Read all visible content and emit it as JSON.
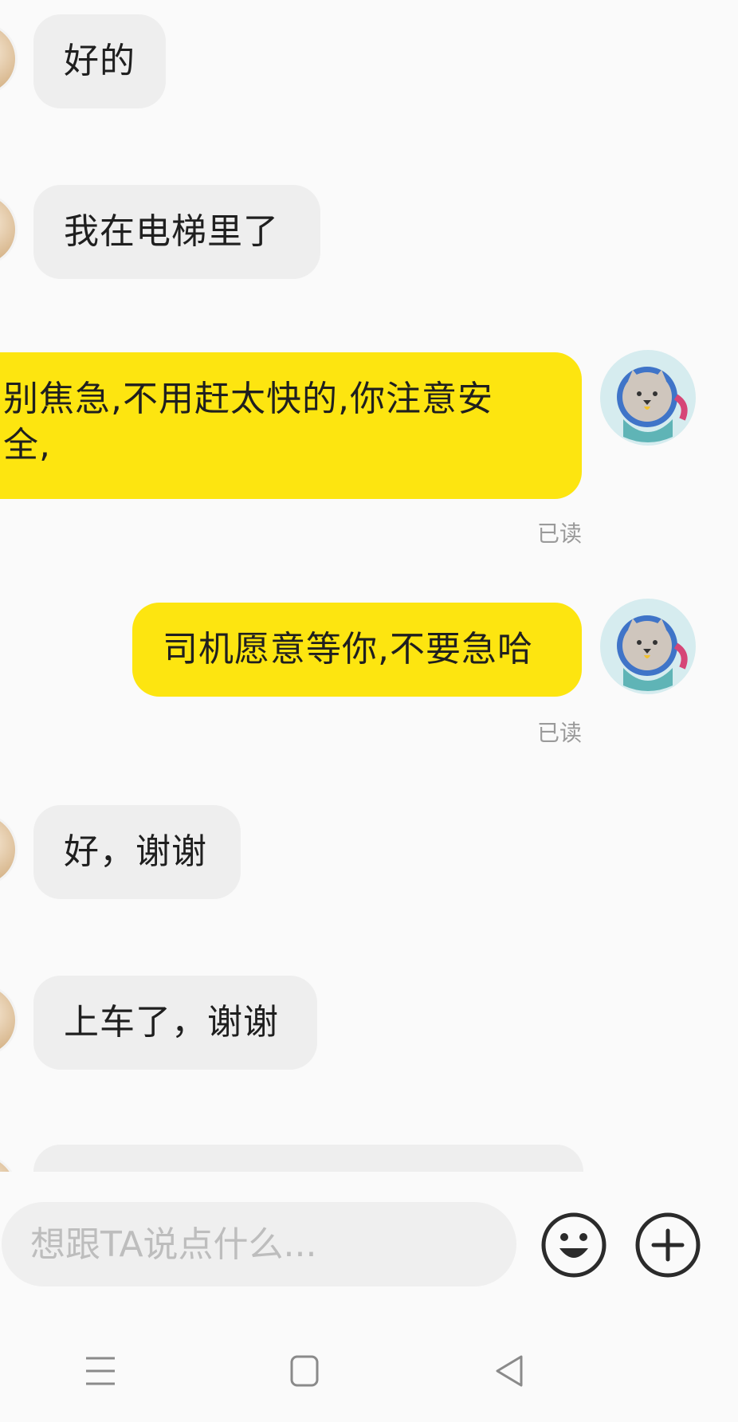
{
  "messages": [
    {
      "side": "incoming",
      "text": "好的"
    },
    {
      "side": "incoming",
      "text": "我在电梯里了"
    },
    {
      "side": "outgoing",
      "text": "别焦急,不用赶太快的,你注意安全,",
      "status": "已读"
    },
    {
      "side": "outgoing",
      "text": "司机愿意等你,不要急哈",
      "status": "已读"
    },
    {
      "side": "incoming",
      "text": "好，谢谢"
    },
    {
      "side": "incoming",
      "text": "上车了，谢谢"
    }
  ],
  "composer": {
    "placeholder": "想跟TA说点什么...",
    "emoji_icon": "smiley-face-icon",
    "add_icon": "plus-circle-icon"
  },
  "navigation": {
    "menu_icon": "menu-lines-icon",
    "home_icon": "square-home-icon",
    "back_icon": "triangle-back-icon"
  },
  "colors": {
    "outgoing_bubble": "#fde510",
    "incoming_bubble": "#eeeeee",
    "read_status": "#9a9a9a"
  }
}
